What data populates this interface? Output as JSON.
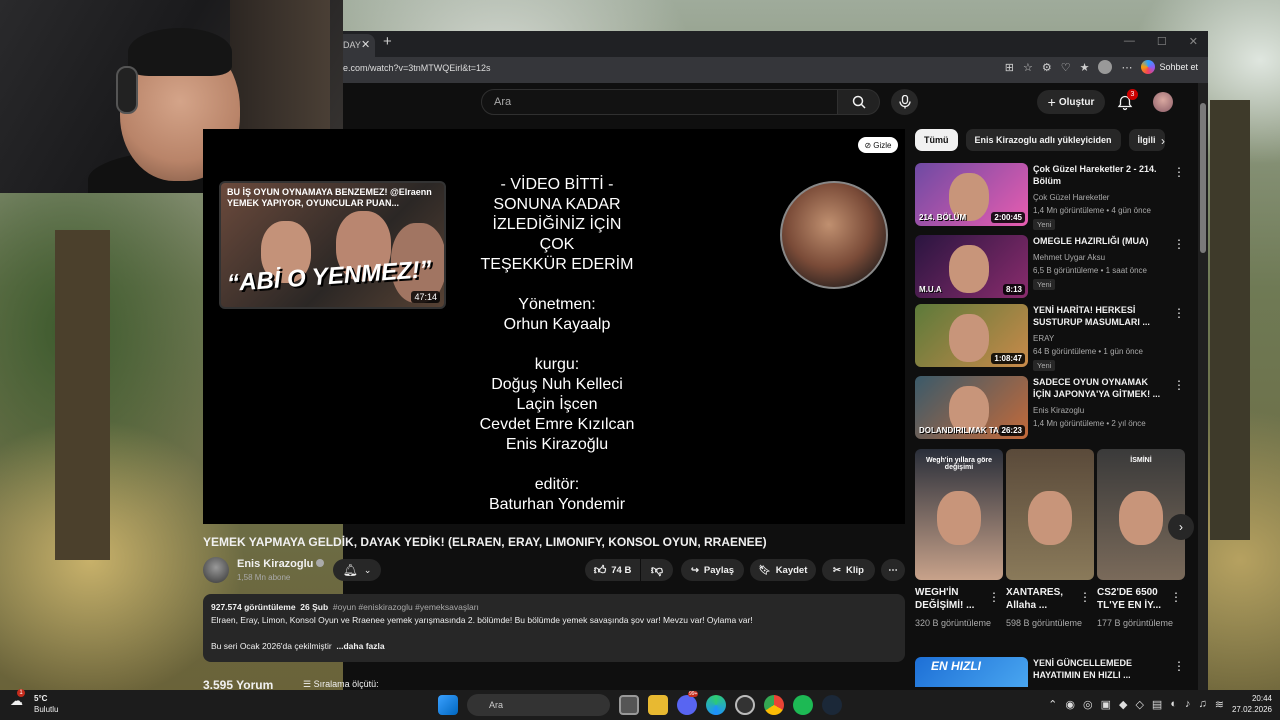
{
  "browser": {
    "tab_fragment": "DAY",
    "close_glyph": "✕",
    "new_tab": "+",
    "url": "e.com/watch?v=3tnMTWQEirl&t=12s",
    "copilot": "Sohbet et"
  },
  "yt": {
    "search_placeholder": "Ara",
    "create": "Oluştur",
    "notifications": "3",
    "player": {
      "hide": "Gizle",
      "endcard_title": "BU İŞ OYUN OYNAMAYA BENZEMEZ! @Elraenn YEMEK YAPIYOR, OYUNCULAR PUAN...",
      "endcard_banner": "“ABİ O YENMEZ!”",
      "endcard_duration": "47:14",
      "credits": "- VİDEO BİTTİ -\nSONUNA KADAR\nİZLEDİĞİNİZ İÇİN\nÇOK\nTEŞEKKÜR EDERİM\n\nYönetmen:\nOrhun Kayaalp\n\nkurgu:\nDoğuş Nuh Kelleci\nLaçin İşcen\nCevdet Emre Kızılcan\nEnis Kirazoğlu\n\neditör:\nBaturhan Yondemir"
    },
    "video": {
      "title": "YEMEK YAPMAYA GELDİK, DAYAK YEDİK! (ELRAEN, ERAY, LIMONIFY, KONSOL OYUN, RRAENEE)",
      "channel": "Enis Kirazoglu",
      "subs": "1,58 Mn abone",
      "likes": "74 B",
      "share": "Paylaş",
      "save": "Kaydet",
      "clip": "Klip",
      "views": "927.574 görüntüleme",
      "date": "26 Şub",
      "tags": "#oyun #eniskirazoglu #yemeksavaşları",
      "desc_line1": "Elraen, Eray, Limon, Konsol Oyun ve Rraenee yemek yarışmasında 2. bölümde! Bu bölümde yemek savaşında şov var! Mevzu var! Oylama var!",
      "desc_line2": "Bu seri Ocak 2026'da çekilmiştir",
      "more": "...daha fazla",
      "comments": "3.595 Yorum",
      "sort": "Sıralama ölçütü:"
    },
    "chips": [
      "Tümü",
      "Enis Kirazoglu adlı yükleyiciden",
      "İlgili"
    ],
    "recs": [
      {
        "title": "Çok Güzel Hareketler 2 - 214. Bölüm",
        "channel": "Çok Güzel Hareketler",
        "meta": "1,4 Mn görüntüleme • 4 gün önce",
        "badge": "Yeni",
        "duration": "2:00:45",
        "thumb_text": "214. BÖLÜM",
        "c1": "#6e4aa3",
        "c2": "#e85db0"
      },
      {
        "title": "OMEGLE HAZIRLIĞI (MUA)",
        "channel": "Mehmet Uygar Aksu",
        "meta": "6,5 B görüntüleme • 1 saat önce",
        "badge": "Yeni",
        "duration": "8:13",
        "thumb_text": "M.U.A",
        "c1": "#2a1540",
        "c2": "#8a2c6d"
      },
      {
        "title": "YENİ HARİTA! HERKESİ SUSTURUP MASUMLARI ...",
        "channel": "ERAY",
        "meta": "64 B görüntüleme • 1 gün önce",
        "badge": "Yeni",
        "duration": "1:08:47",
        "thumb_text": "",
        "c1": "#5c7a3a",
        "c2": "#c98a4a"
      },
      {
        "title": "SADECE OYUN OYNAMAK İÇİN JAPONYA'YA GİTMEK! ...",
        "channel": "Enis Kirazoglu",
        "meta": "1,4 Mn görüntüleme • 2 yıl önce",
        "badge": "",
        "duration": "26:23",
        "thumb_text": "DOLANDIRILMAK TACİZ",
        "c1": "#3a5a6a",
        "c2": "#c46a3a"
      }
    ],
    "shorts": [
      {
        "title": "WEGH'İN DEĞİŞİMİ! ...",
        "views": "320 B görüntüleme",
        "top": "Wegh'in yıllara göre değişimi",
        "c1": "#2a2f3a",
        "c2": "#c8a28a"
      },
      {
        "title": "XANTARES, Allaha ...",
        "views": "598 B görüntüleme",
        "top": "",
        "c1": "#5a4a3a",
        "c2": "#8a7a5a"
      },
      {
        "title": "CS2'DE 6500 TL'YE EN İY...",
        "views": "177 B görüntüleme",
        "top": "İSMİNİ",
        "c1": "#3a3a3a",
        "c2": "#7a6a5a"
      }
    ],
    "next_rec": {
      "title": "YENİ GÜNCELLEMEDE HAYATIMIN EN HIZLI ...",
      "thumb_text": "EN HIZLI"
    }
  },
  "taskbar": {
    "temp": "5°C",
    "weather": "Bulutlu",
    "search": "Ara",
    "time": "20:44",
    "date": "27.02.2026",
    "weather_badge": "1",
    "discord_badge": "99+"
  }
}
